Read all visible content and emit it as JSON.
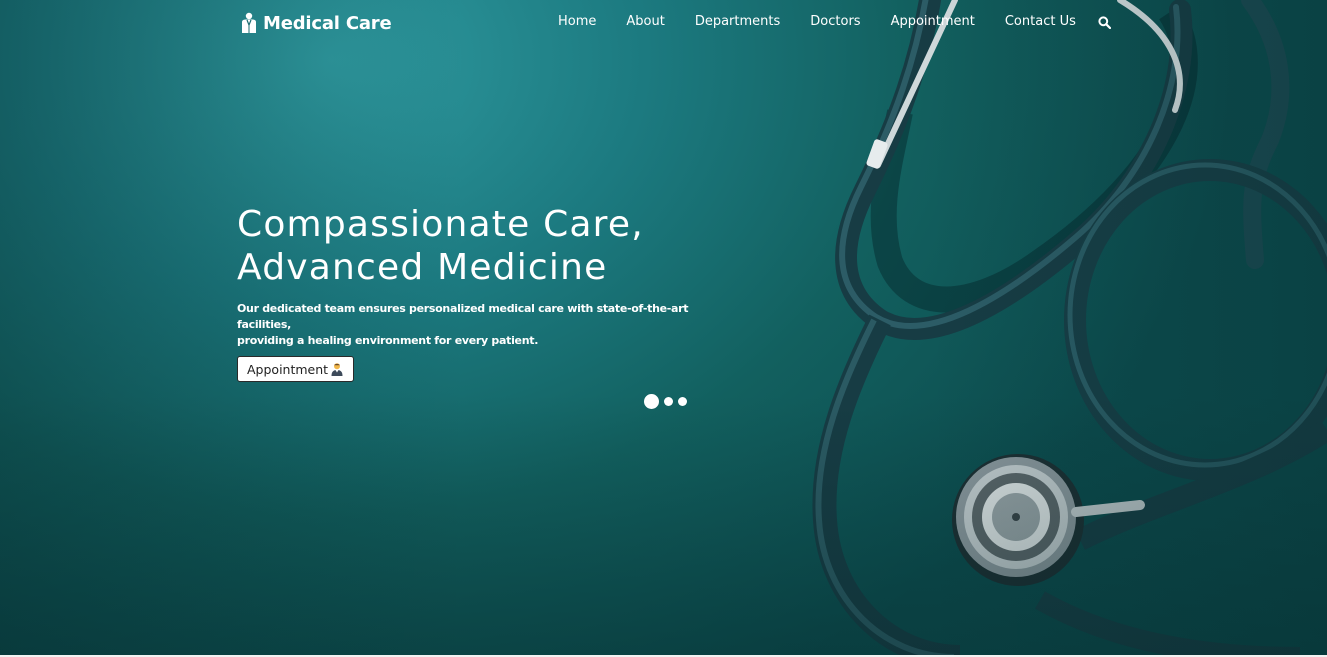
{
  "brand": {
    "name": "Medical Care",
    "icon": "doctor-coat-icon"
  },
  "nav": {
    "items": [
      {
        "label": "Home"
      },
      {
        "label": "About"
      },
      {
        "label": "Departments"
      },
      {
        "label": "Doctors"
      },
      {
        "label": "Appointment"
      },
      {
        "label": "Contact Us"
      }
    ],
    "search_icon": "search-icon"
  },
  "hero": {
    "headline_line1": "Compassionate Care,",
    "headline_line2": "Advanced Medicine",
    "subtext_line1": "Our dedicated team ensures personalized medical care with state-of-the-art facilities,",
    "subtext_line2": "providing a healing environment for every patient.",
    "cta_label": "Appointment",
    "cta_icon": "health-worker-icon",
    "background_image": "stethoscope-photo",
    "slider": {
      "total": 3,
      "active": 1
    }
  },
  "colors": {
    "background": "#1c7a80",
    "text": "#ffffff",
    "button_bg": "#ffffff",
    "button_text": "#222222"
  }
}
